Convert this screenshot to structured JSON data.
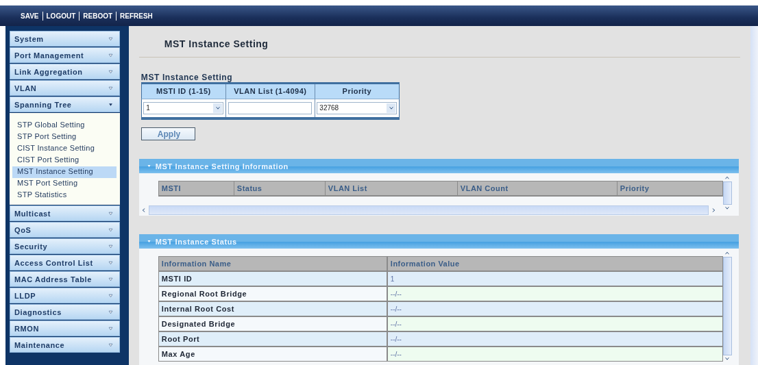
{
  "toolbar": {
    "links": [
      "SAVE",
      "LOGOUT",
      "REBOOT",
      "REFRESH"
    ]
  },
  "sidebar": {
    "items": [
      {
        "label": "System",
        "expanded": false
      },
      {
        "label": "Port Management",
        "expanded": false
      },
      {
        "label": "Link Aggregation",
        "expanded": false
      },
      {
        "label": "VLAN",
        "expanded": false
      },
      {
        "label": "Spanning Tree",
        "expanded": true,
        "children": [
          {
            "label": "STP Global Setting",
            "selected": false
          },
          {
            "label": "STP Port Setting",
            "selected": false
          },
          {
            "label": "CIST Instance Setting",
            "selected": false
          },
          {
            "label": "CIST Port Setting",
            "selected": false
          },
          {
            "label": "MST Instance Setting",
            "selected": true
          },
          {
            "label": "MST Port Setting",
            "selected": false
          },
          {
            "label": "STP Statistics",
            "selected": false
          }
        ]
      },
      {
        "label": "Multicast",
        "expanded": false
      },
      {
        "label": "QoS",
        "expanded": false
      },
      {
        "label": "Security",
        "expanded": false
      },
      {
        "label": "Access Control List",
        "expanded": false
      },
      {
        "label": "MAC Address Table",
        "expanded": false
      },
      {
        "label": "LLDP",
        "expanded": false
      },
      {
        "label": "Diagnostics",
        "expanded": false
      },
      {
        "label": "RMON",
        "expanded": false
      },
      {
        "label": "Maintenance",
        "expanded": false
      }
    ]
  },
  "page_title": "MST Instance Setting",
  "form": {
    "title": "MST Instance Setting",
    "fields": [
      {
        "label": "MSTI ID (1-15)",
        "kind": "select",
        "value": "1"
      },
      {
        "label": "VLAN List (1-4094)",
        "kind": "text"
      },
      {
        "label": "Priority",
        "kind": "select",
        "value": "32768"
      }
    ],
    "apply_button": "Apply"
  },
  "info_panel": {
    "title": "MST Instance Setting Information",
    "columns": [
      "MSTI",
      "Status",
      "VLAN List",
      "VLAN Count",
      "Priority"
    ]
  },
  "status_panel": {
    "title": "MST Instance Status",
    "columns": [
      "Information Name",
      "Information Value"
    ],
    "rows": [
      [
        "MSTI ID",
        "1"
      ],
      [
        "Regional Root Bridge",
        "--/--"
      ],
      [
        "Internal Root Cost",
        "--/--"
      ],
      [
        "Designated Bridge",
        "--/--"
      ],
      [
        "Root Port",
        "--/--"
      ],
      [
        "Max Age",
        "--/--"
      ]
    ]
  }
}
